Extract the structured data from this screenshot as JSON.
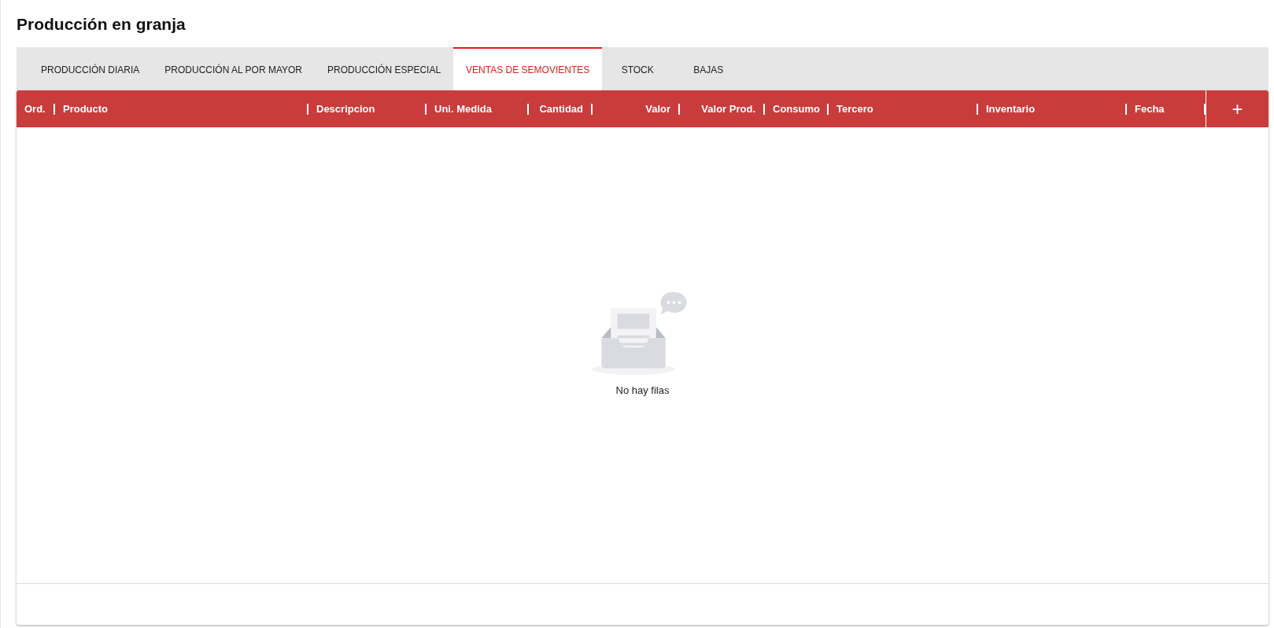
{
  "page": {
    "title": "Producción en granja"
  },
  "tabs": [
    {
      "label": "PRODUCCIÓN DIARIA",
      "selected": false
    },
    {
      "label": "PRODUCCIÓN AL POR MAYOR",
      "selected": false
    },
    {
      "label": "PRODUCCIÓN ESPECIAL",
      "selected": false
    },
    {
      "label": "VENTAS DE SEMOVIENTES",
      "selected": true
    },
    {
      "label": "STOCK",
      "selected": false
    },
    {
      "label": "BAJAS",
      "selected": false
    }
  ],
  "table": {
    "columns": [
      {
        "label": "Ord.",
        "right_aligned": false
      },
      {
        "label": "Producto",
        "right_aligned": false
      },
      {
        "label": "Descripcion",
        "right_aligned": false
      },
      {
        "label": "Uni. Medida",
        "right_aligned": false
      },
      {
        "label": "Cantidad",
        "right_aligned": true
      },
      {
        "label": "Valor",
        "right_aligned": true
      },
      {
        "label": "Valor Prod.",
        "right_aligned": true
      },
      {
        "label": "Consumo",
        "right_aligned": false
      },
      {
        "label": "Tercero",
        "right_aligned": false
      },
      {
        "label": "Inventario",
        "right_aligned": false
      },
      {
        "label": "Fecha",
        "right_aligned": false
      }
    ],
    "add_button": "+",
    "empty_message": "No hay filas"
  }
}
